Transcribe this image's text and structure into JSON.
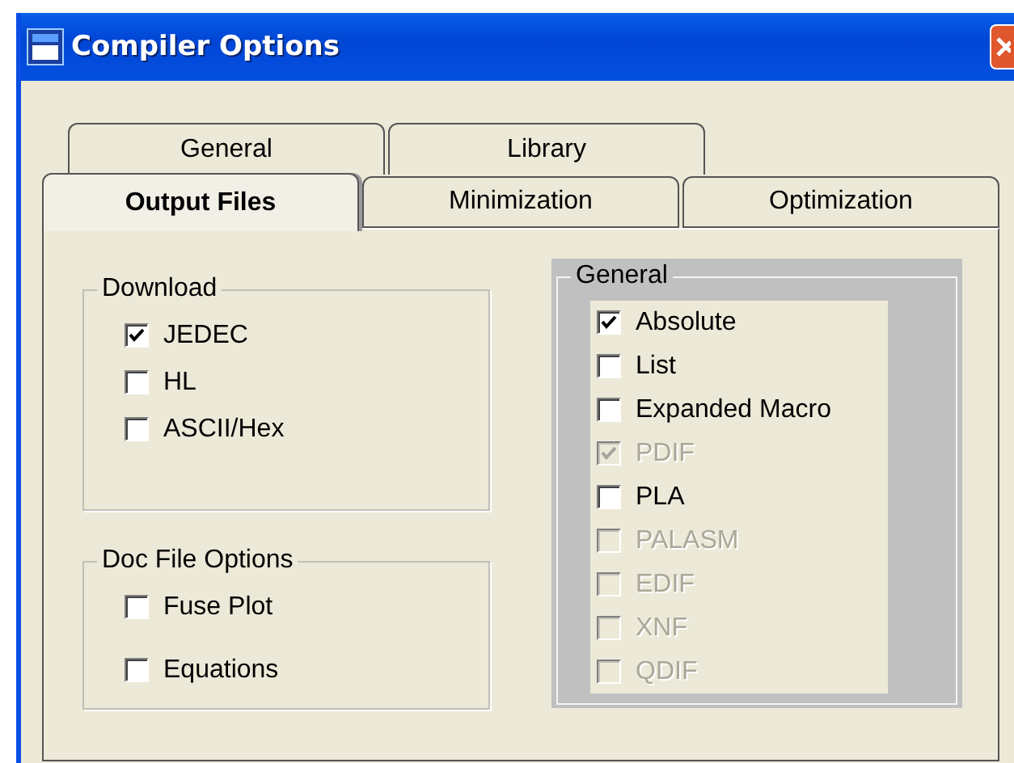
{
  "window": {
    "title": "Compiler Options"
  },
  "tab_rows": [
    {
      "tabs": [
        {
          "label": "General",
          "selected": false
        },
        {
          "label": "Library",
          "selected": false
        }
      ]
    },
    {
      "tabs": [
        {
          "label": "Output Files",
          "selected": true
        },
        {
          "label": "Minimization",
          "selected": false
        },
        {
          "label": "Optimization",
          "selected": false
        }
      ]
    }
  ],
  "columns": [
    {
      "groups": [
        {
          "title": "Download",
          "kind": "plain",
          "options": [
            {
              "label": "JEDEC",
              "checked": true,
              "disabled": false
            },
            {
              "label": "HL",
              "checked": false,
              "disabled": false
            },
            {
              "label": "ASCII/Hex",
              "checked": false,
              "disabled": false
            }
          ]
        },
        {
          "title": "Doc File Options",
          "kind": "plain",
          "options": [
            {
              "label": "Fuse Plot",
              "checked": false,
              "disabled": false
            },
            {
              "label": "Equations",
              "checked": false,
              "disabled": false
            }
          ]
        }
      ]
    },
    {
      "groups": [
        {
          "title": "General",
          "kind": "shaded",
          "options": [
            {
              "label": "Absolute",
              "checked": true,
              "disabled": false
            },
            {
              "label": "List",
              "checked": false,
              "disabled": false
            },
            {
              "label": "Expanded Macro",
              "checked": false,
              "disabled": false
            },
            {
              "label": "PDIF",
              "checked": true,
              "disabled": true
            },
            {
              "label": "PLA",
              "checked": false,
              "disabled": false
            },
            {
              "label": "PALASM",
              "checked": false,
              "disabled": true
            },
            {
              "label": "EDIF",
              "checked": false,
              "disabled": true
            },
            {
              "label": "XNF",
              "checked": false,
              "disabled": true
            },
            {
              "label": "QDIF",
              "checked": false,
              "disabled": true
            }
          ]
        }
      ]
    }
  ]
}
